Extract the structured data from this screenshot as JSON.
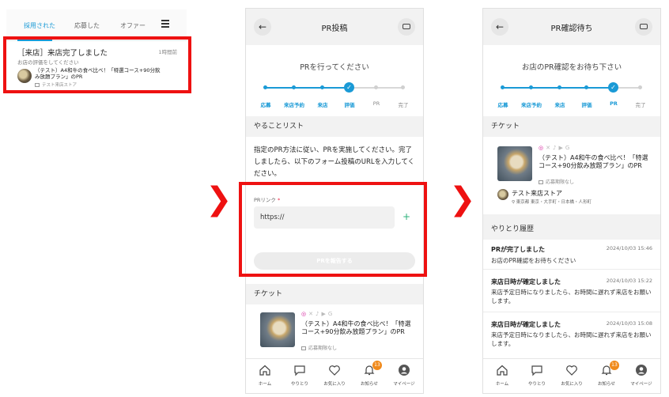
{
  "colors": {
    "accent": "#1a9ad6",
    "highlight": "#ee1111",
    "badge": "#f08a1c",
    "plus": "#2bb07a"
  },
  "panel1": {
    "tabs": [
      {
        "label": "採用された",
        "active": true
      },
      {
        "label": "応募した",
        "active": false
      },
      {
        "label": "オファー",
        "active": false
      }
    ],
    "menu_icon": "hamburger-icon",
    "notification": {
      "title": "［来店］来店完了しました",
      "time": "1時間前",
      "subtitle": "お店の評価をしてください",
      "item": "（テスト）A4和牛の食べ比べ！「特選コース+90分飲み放題プラン」のPR",
      "store": "テスト来店ストア"
    }
  },
  "steps": [
    "応募",
    "来店予約",
    "来店",
    "評価",
    "PR",
    "完了"
  ],
  "panel2": {
    "title": "PR投稿",
    "status": "PRを行ってください",
    "current_step": 3,
    "todo_header": "やることリスト",
    "todo_text": "指定のPR方法に従い、PRを実施してください。完了しましたら、以下のフォーム投稿のURLを入力してください。",
    "pr_link_label": "PRリンク",
    "required_mark": "*",
    "url_value": "https://",
    "submit_label": "PRを報告する",
    "ticket_header": "チケット",
    "ticket_name": "（テスト）A4和牛の食べ比べ！「特選コース+90分飲み放題プラン」のPR",
    "deadline": "応募期限なし"
  },
  "panel3": {
    "title": "PR確認待ち",
    "status": "お店のPR確認をお待ち下さい",
    "current_step": 4,
    "ticket_header": "チケット",
    "ticket_name": "（テスト）A4和牛の食べ比べ！「特選コース+90分飲み放題プラン」のPR",
    "deadline": "応募期限なし",
    "store_name": "テスト来店ストア",
    "store_address": "東京都 東京・大手町・日本橋・人形町",
    "history_header": "やりとり履歴",
    "history": [
      {
        "title": "PRが完了しました",
        "date": "2024/10/03 15:46",
        "body": "お店のPR確認をお待ちください"
      },
      {
        "title": "来店日時が確定しました",
        "date": "2024/10/03 15:22",
        "body": "来店予定日時になりましたら、お時間に遅れず来店をお願いします。"
      },
      {
        "title": "来店日時が確定しました",
        "date": "2024/10/03 15:08",
        "body": "来店予定日時になりましたら、お時間に遅れず来店をお願いします。"
      }
    ]
  },
  "nav": [
    {
      "label": "ホーム",
      "icon": "home-icon"
    },
    {
      "label": "やりとり",
      "icon": "chat-icon"
    },
    {
      "label": "お気に入り",
      "icon": "heart-icon"
    },
    {
      "label": "お知らせ",
      "icon": "bell-icon",
      "badge": "13"
    },
    {
      "label": "マイページ",
      "icon": "user-icon"
    }
  ]
}
